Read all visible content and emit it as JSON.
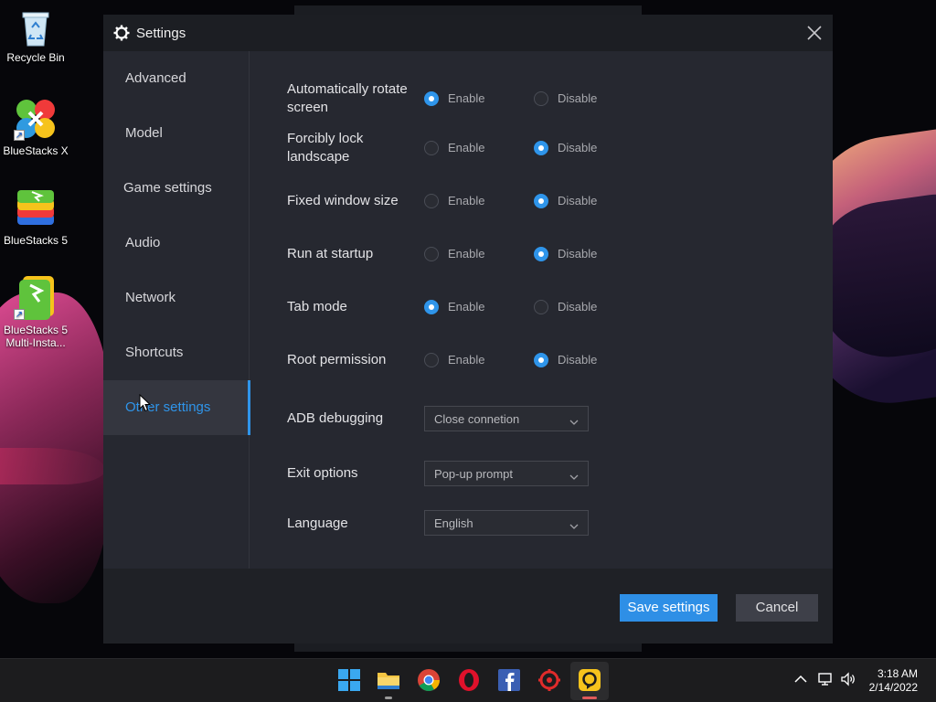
{
  "desktop": {
    "icons": [
      {
        "label": "Recycle Bin"
      },
      {
        "label": "BlueStacks X"
      },
      {
        "label": "BlueStacks 5"
      },
      {
        "label": "BlueStacks 5 Multi-Insta..."
      }
    ]
  },
  "window": {
    "title": "Settings",
    "sidebar": {
      "items": [
        {
          "label": "Advanced"
        },
        {
          "label": "Model"
        },
        {
          "label": "Game settings"
        },
        {
          "label": "Audio"
        },
        {
          "label": "Network"
        },
        {
          "label": "Shortcuts"
        },
        {
          "label": "Other settings",
          "active": true
        }
      ]
    },
    "settings": {
      "auto_rotate": {
        "label": "Automatically rotate screen",
        "value": "Enable"
      },
      "force_landscape": {
        "label": "Forcibly lock landscape",
        "value": "Disable"
      },
      "fixed_window": {
        "label": "Fixed window size",
        "value": "Disable"
      },
      "run_startup": {
        "label": "Run at startup",
        "value": "Disable"
      },
      "tab_mode": {
        "label": "Tab mode",
        "value": "Enable"
      },
      "root_permission": {
        "label": "Root permission",
        "value": "Disable"
      },
      "radio_labels": {
        "enable": "Enable",
        "disable": "Disable"
      },
      "adb": {
        "label": "ADB debugging",
        "value": "Close connetion"
      },
      "exit": {
        "label": "Exit options",
        "value": "Pop-up prompt"
      },
      "language": {
        "label": "Language",
        "value": "English"
      }
    },
    "footer": {
      "save_label": "Save settings",
      "cancel_label": "Cancel"
    }
  },
  "taskbar": {
    "clock": {
      "time": "3:18 AM",
      "date": "2/14/2022"
    }
  },
  "colors": {
    "accent": "#2f95ea",
    "window_bg": "#262830",
    "titlebar_bg": "#1c1e23"
  }
}
